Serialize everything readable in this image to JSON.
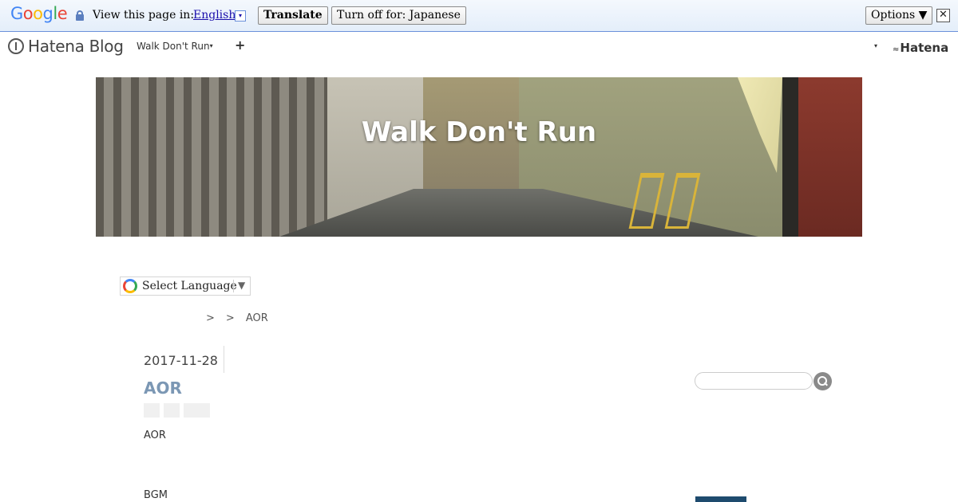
{
  "translate_bar": {
    "logo": "Google",
    "prompt": "View this page in:",
    "language": "English",
    "language_arrow": "▾",
    "translate_label": "Translate",
    "turn_off_label": "Turn off for: Japanese",
    "options_label": "Options ▼",
    "close_label": "✕"
  },
  "hatena_bar": {
    "logo_text": "Hatena Blog",
    "blog_menu_label": "Walk Don't Run",
    "caret": "▾",
    "add_label": "+",
    "right_caret": "▾",
    "hatena_label": "Hatena"
  },
  "header": {
    "title": "Walk Don't Run"
  },
  "language_selector": {
    "label": "Select Language",
    "arrow": "▼"
  },
  "breadcrumb": {
    "items": [
      ">",
      ">",
      "AOR"
    ]
  },
  "entry": {
    "date": "2017-11-28",
    "title": "AOR",
    "body_lines": [
      "AOR",
      "BGM"
    ]
  }
}
